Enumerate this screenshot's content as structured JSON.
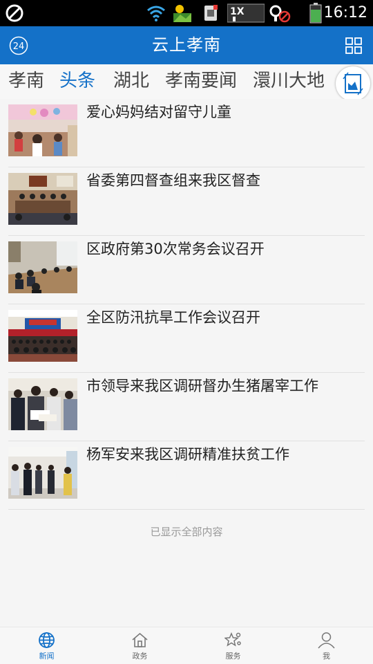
{
  "status_bar": {
    "time": "16:12",
    "icons": [
      "blocked-icon",
      "wifi-icon",
      "gallery-icon",
      "sim-icon",
      "network-1x-icon",
      "gps-icon",
      "battery-icon"
    ],
    "network_label": "1X",
    "battery_color": "#4caf50"
  },
  "app_bar": {
    "title": "云上孝南",
    "weather_value": "24",
    "background": "#1471c8"
  },
  "tabs": {
    "items": [
      {
        "label": "孝南",
        "active": false
      },
      {
        "label": "头条",
        "active": true
      },
      {
        "label": "湖北",
        "active": false
      },
      {
        "label": "孝南要闻",
        "active": false
      },
      {
        "label": "澴川大地",
        "active": false
      }
    ],
    "active_color": "#1471c8"
  },
  "news": {
    "items": [
      {
        "title": "爱心妈妈结对留守儿童",
        "thumb": "classroom-children-photo"
      },
      {
        "title": "省委第四督查组来我区督查",
        "thumb": "meeting-room-photo"
      },
      {
        "title": "区政府第30次常务会议召开",
        "thumb": "meeting-table-photo"
      },
      {
        "title": "全区防汛抗旱工作会议召开",
        "thumb": "auditorium-photo"
      },
      {
        "title": "市领导来我区调研督办生猪屠宰工作",
        "thumb": "officials-documents-photo"
      },
      {
        "title": "杨军安来我区调研精准扶贫工作",
        "thumb": "hallway-visit-photo"
      }
    ],
    "end_note": "已显示全部内容"
  },
  "bottom_nav": {
    "items": [
      {
        "label": "新闻",
        "icon": "globe-icon",
        "active": true
      },
      {
        "label": "政务",
        "icon": "home-icon",
        "active": false
      },
      {
        "label": "服务",
        "icon": "star-services-icon",
        "active": false
      },
      {
        "label": "我",
        "icon": "person-icon",
        "active": false
      }
    ]
  }
}
